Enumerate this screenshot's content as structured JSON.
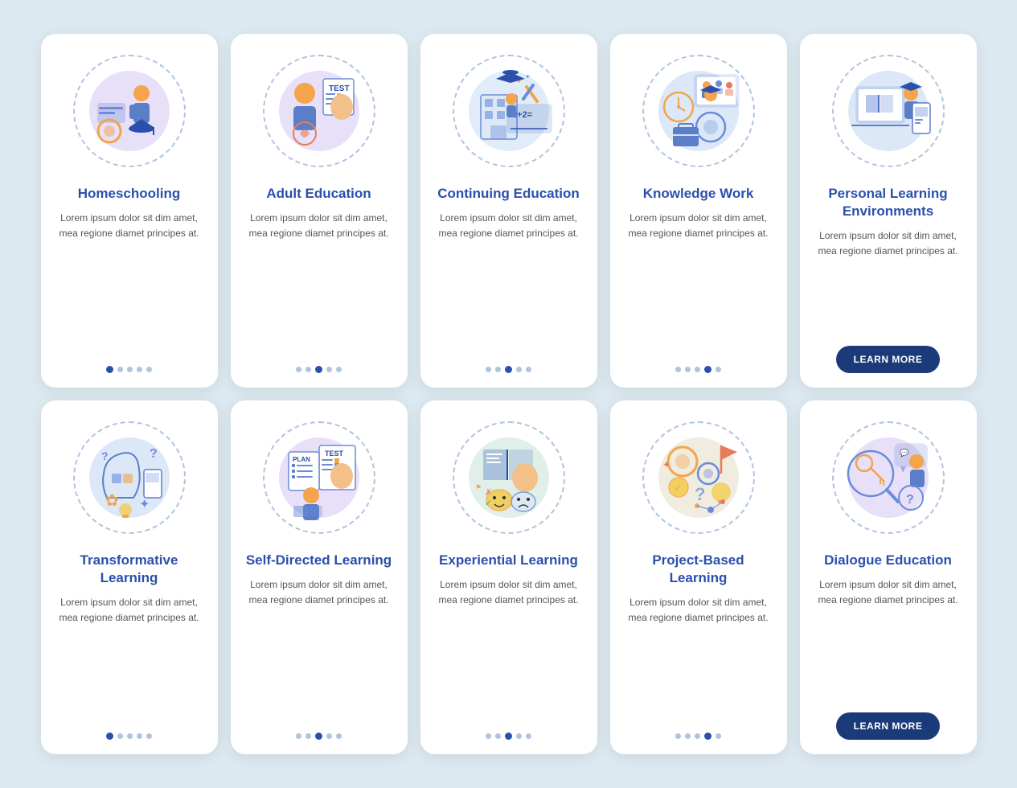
{
  "cards": [
    {
      "id": "homeschooling",
      "title": "Homeschooling",
      "body": "Lorem ipsum dolor sit dim amet, mea regione diamet principes at.",
      "dots": [
        1,
        0,
        0,
        0,
        0
      ],
      "has_button": false,
      "icon_type": "homeschooling"
    },
    {
      "id": "adult-education",
      "title": "Adult Education",
      "body": "Lorem ipsum dolor sit dim amet, mea regione diamet principes at.",
      "dots": [
        0,
        0,
        1,
        0,
        0
      ],
      "has_button": false,
      "icon_type": "adult-education"
    },
    {
      "id": "continuing-education",
      "title": "Continuing Education",
      "body": "Lorem ipsum dolor sit dim amet, mea regione diamet principes at.",
      "dots": [
        0,
        0,
        1,
        0,
        0
      ],
      "has_button": false,
      "icon_type": "continuing-education"
    },
    {
      "id": "knowledge-work",
      "title": "Knowledge Work",
      "body": "Lorem ipsum dolor sit dim amet, mea regione diamet principes at.",
      "dots": [
        0,
        0,
        0,
        1,
        0
      ],
      "has_button": false,
      "icon_type": "knowledge-work"
    },
    {
      "id": "personal-learning",
      "title": "Personal Learning Environments",
      "body": "Lorem ipsum dolor sit dim amet, mea regione diamet principes at.",
      "dots": [],
      "has_button": true,
      "button_label": "LEARN MORE",
      "icon_type": "personal-learning"
    },
    {
      "id": "transformative-learning",
      "title": "Transformative Learning",
      "body": "Lorem ipsum dolor sit dim amet, mea regione diamet principes at.",
      "dots": [
        1,
        0,
        0,
        0,
        0
      ],
      "has_button": false,
      "icon_type": "transformative-learning"
    },
    {
      "id": "self-directed-learning",
      "title": "Self-Directed Learning",
      "body": "Lorem ipsum dolor sit dim amet, mea regione diamet principes at.",
      "dots": [
        0,
        0,
        1,
        0,
        0
      ],
      "has_button": false,
      "icon_type": "self-directed-learning"
    },
    {
      "id": "experiential-learning",
      "title": "Experiential Learning",
      "body": "Lorem ipsum dolor sit dim amet, mea regione diamet principes at.",
      "dots": [
        0,
        0,
        1,
        0,
        0
      ],
      "has_button": false,
      "icon_type": "experiential-learning"
    },
    {
      "id": "project-based-learning",
      "title": "Project-Based Learning",
      "body": "Lorem ipsum dolor sit dim amet, mea regione diamet principes at.",
      "dots": [
        0,
        0,
        0,
        1,
        0
      ],
      "has_button": false,
      "icon_type": "project-based-learning"
    },
    {
      "id": "dialogue-education",
      "title": "Dialogue Education",
      "body": "Lorem ipsum dolor sit dim amet, mea regione diamet principes at.",
      "dots": [],
      "has_button": true,
      "button_label": "LEARN MORE",
      "icon_type": "dialogue-education"
    }
  ]
}
